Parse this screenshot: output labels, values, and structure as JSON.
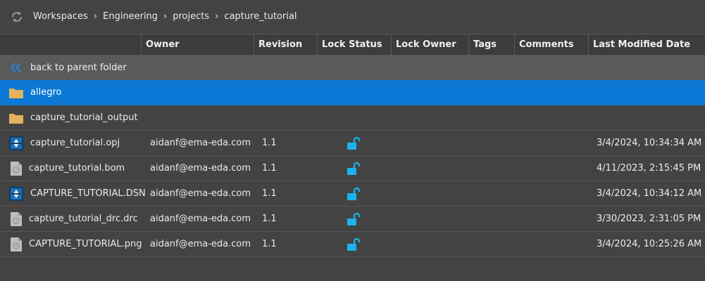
{
  "breadcrumb": {
    "items": [
      "Workspaces",
      "Engineering",
      "projects",
      "capture_tutorial"
    ],
    "separator": "›"
  },
  "columns": {
    "owner": "Owner",
    "revision": "Revision",
    "lock_status": "Lock Status",
    "lock_owner": "Lock Owner",
    "tags": "Tags",
    "comments": "Comments",
    "last_modified": "Last Modified Date"
  },
  "parent_row": {
    "label": "back to parent folder"
  },
  "rows": [
    {
      "name": "allegro",
      "type": "folder",
      "selected": true,
      "owner": "",
      "revision": "",
      "locked": false,
      "date": ""
    },
    {
      "name": "capture_tutorial_output",
      "type": "folder",
      "selected": false,
      "owner": "",
      "revision": "",
      "locked": false,
      "date": ""
    },
    {
      "name": "capture_tutorial.opj",
      "type": "capture-file",
      "selected": false,
      "owner": "aidanf@ema-eda.com",
      "revision": "1.1",
      "locked": true,
      "date": "3/4/2024, 10:34:34 AM"
    },
    {
      "name": "capture_tutorial.bom",
      "type": "unknown-file",
      "selected": false,
      "owner": "aidanf@ema-eda.com",
      "revision": "1.1",
      "locked": true,
      "date": "4/11/2023, 2:15:45 PM"
    },
    {
      "name": "CAPTURE_TUTORIAL.DSN",
      "type": "capture-file",
      "selected": false,
      "owner": "aidanf@ema-eda.com",
      "revision": "1.1",
      "locked": true,
      "date": "3/4/2024, 10:34:12 AM"
    },
    {
      "name": "capture_tutorial_drc.drc",
      "type": "unknown-file",
      "selected": false,
      "owner": "aidanf@ema-eda.com",
      "revision": "1.1",
      "locked": true,
      "date": "3/30/2023, 2:31:05 PM"
    },
    {
      "name": "CAPTURE_TUTORIAL.png",
      "type": "unknown-file",
      "selected": false,
      "owner": "aidanf@ema-eda.com",
      "revision": "1.1",
      "locked": true,
      "date": "3/4/2024, 10:25:26 AM"
    }
  ],
  "colors": {
    "background": "#434343",
    "header_bg": "#3c3c3c",
    "parent_row_bg": "#5a5a5a",
    "selection": "#0a78d4",
    "lock_icon": "#1ab3f0",
    "folder_icon": "#e6b15f",
    "back_chevron": "#2b7fd6"
  }
}
